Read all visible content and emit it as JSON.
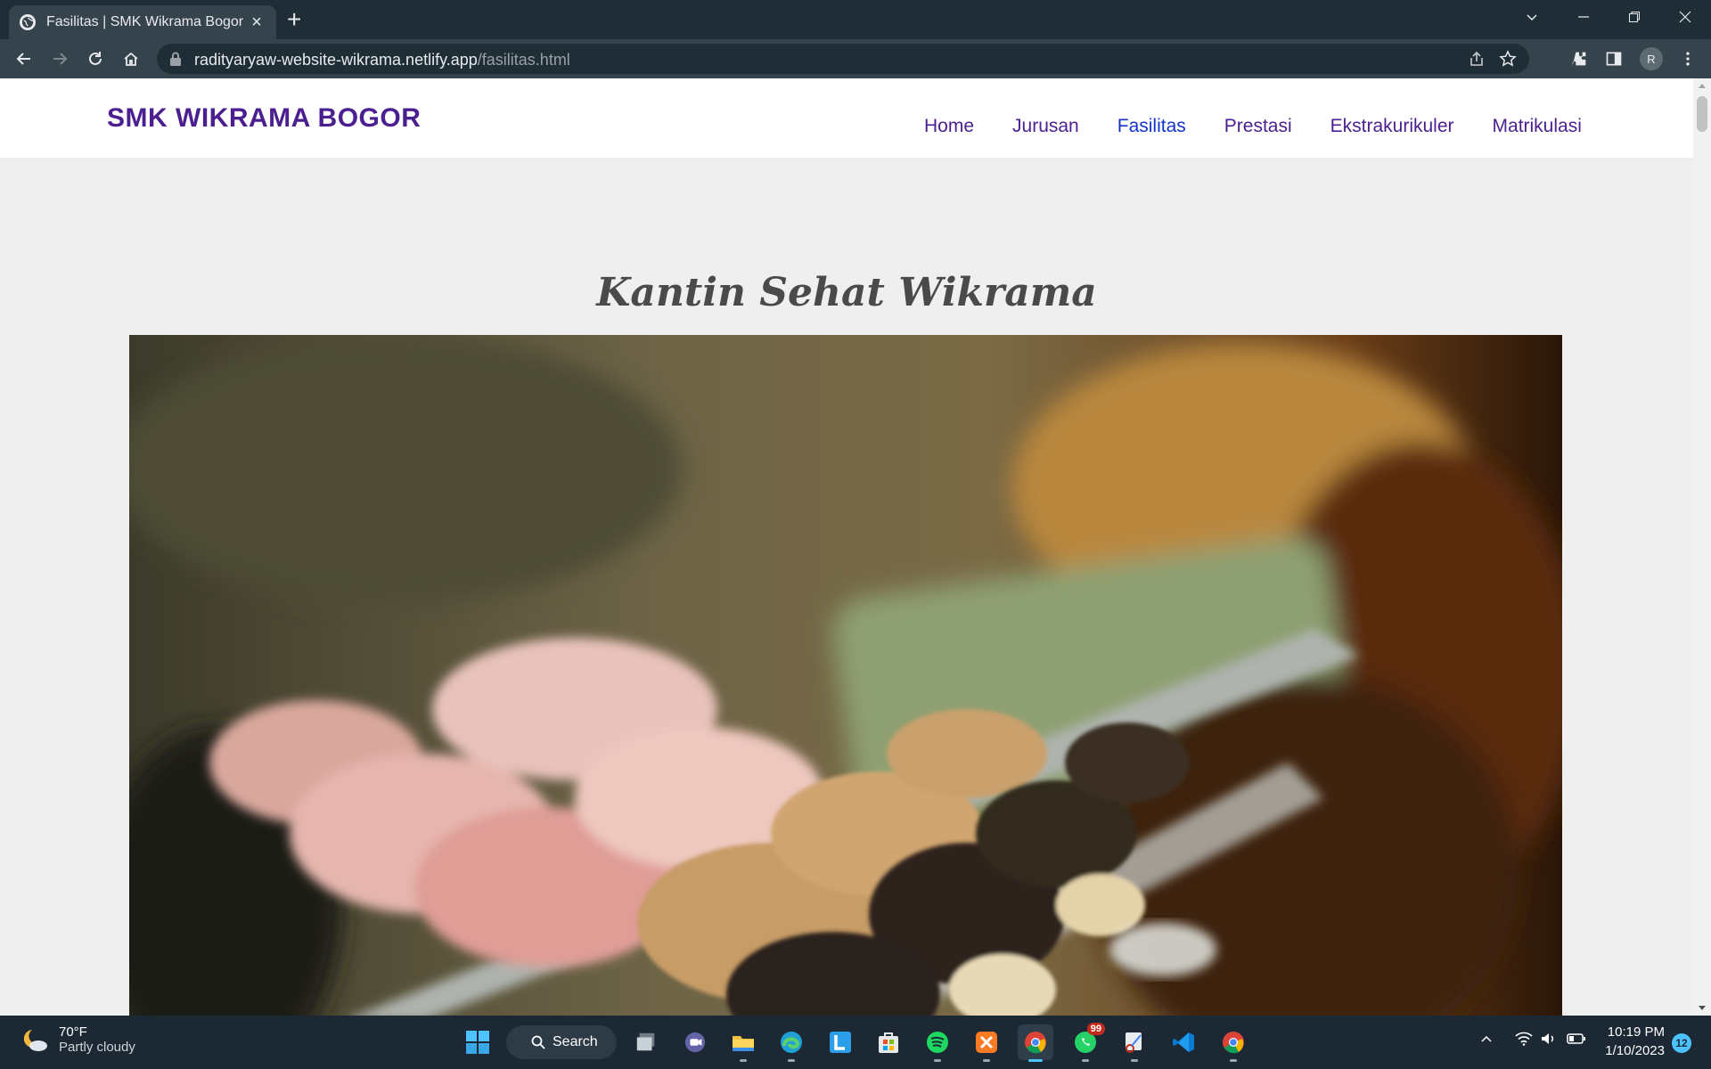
{
  "browser": {
    "tab_title": "Fasilitas | SMK Wikrama Bogor",
    "url_host": "radityaryaw-website-wikrama.netlify.app",
    "url_path": "/fasilitas.html",
    "profile_initial": "R"
  },
  "site": {
    "brand": "SMK WIKRAMA BOGOR",
    "nav": [
      {
        "label": "Home",
        "active": false
      },
      {
        "label": "Jurusan",
        "active": false
      },
      {
        "label": "Fasilitas",
        "active": true
      },
      {
        "label": "Prestasi",
        "active": false
      },
      {
        "label": "Ekstrakurikuler",
        "active": false
      },
      {
        "label": "Matrikulasi",
        "active": false
      }
    ],
    "section_title": "Kantin Sehat Wikrama",
    "colors": {
      "brand": "#4b1f8f",
      "nav_active": "#1434c9",
      "page_bg": "#efefef"
    }
  },
  "taskbar": {
    "weather_temp": "70°F",
    "weather_condition": "Partly cloudy",
    "search_label": "Search",
    "whatsapp_badge": "99",
    "time": "10:19 PM",
    "date": "1/10/2023",
    "notification_count": "12"
  }
}
